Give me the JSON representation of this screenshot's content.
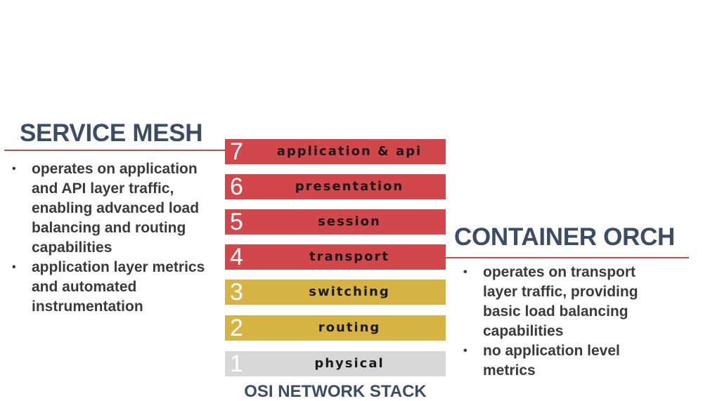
{
  "service_mesh": {
    "title": "SERVICE MESH",
    "bullets": [
      "operates on application and API layer traffic, enabling advanced load balancing and routing capabilities",
      "application layer metrics and automated instrumentation"
    ]
  },
  "container_orch": {
    "title": "CONTAINER ORCH",
    "bullets": [
      "operates on transport layer traffic, providing basic load balancing capabilities",
      "no application level metrics"
    ]
  },
  "stack": {
    "caption": "OSI NETWORK STACK",
    "layers": [
      {
        "number": "7",
        "label": "application & api"
      },
      {
        "number": "6",
        "label": "presentation"
      },
      {
        "number": "5",
        "label": "session"
      },
      {
        "number": "4",
        "label": "transport"
      },
      {
        "number": "3",
        "label": "switching"
      },
      {
        "number": "2",
        "label": "routing"
      },
      {
        "number": "1",
        "label": "physical"
      }
    ]
  },
  "colors": {
    "heading": "#3b4d64",
    "upper_layers": "#d2474b",
    "network_layers": "#d6b343",
    "physical_layer": "#d7d7d7",
    "rule": "#d2474b"
  }
}
